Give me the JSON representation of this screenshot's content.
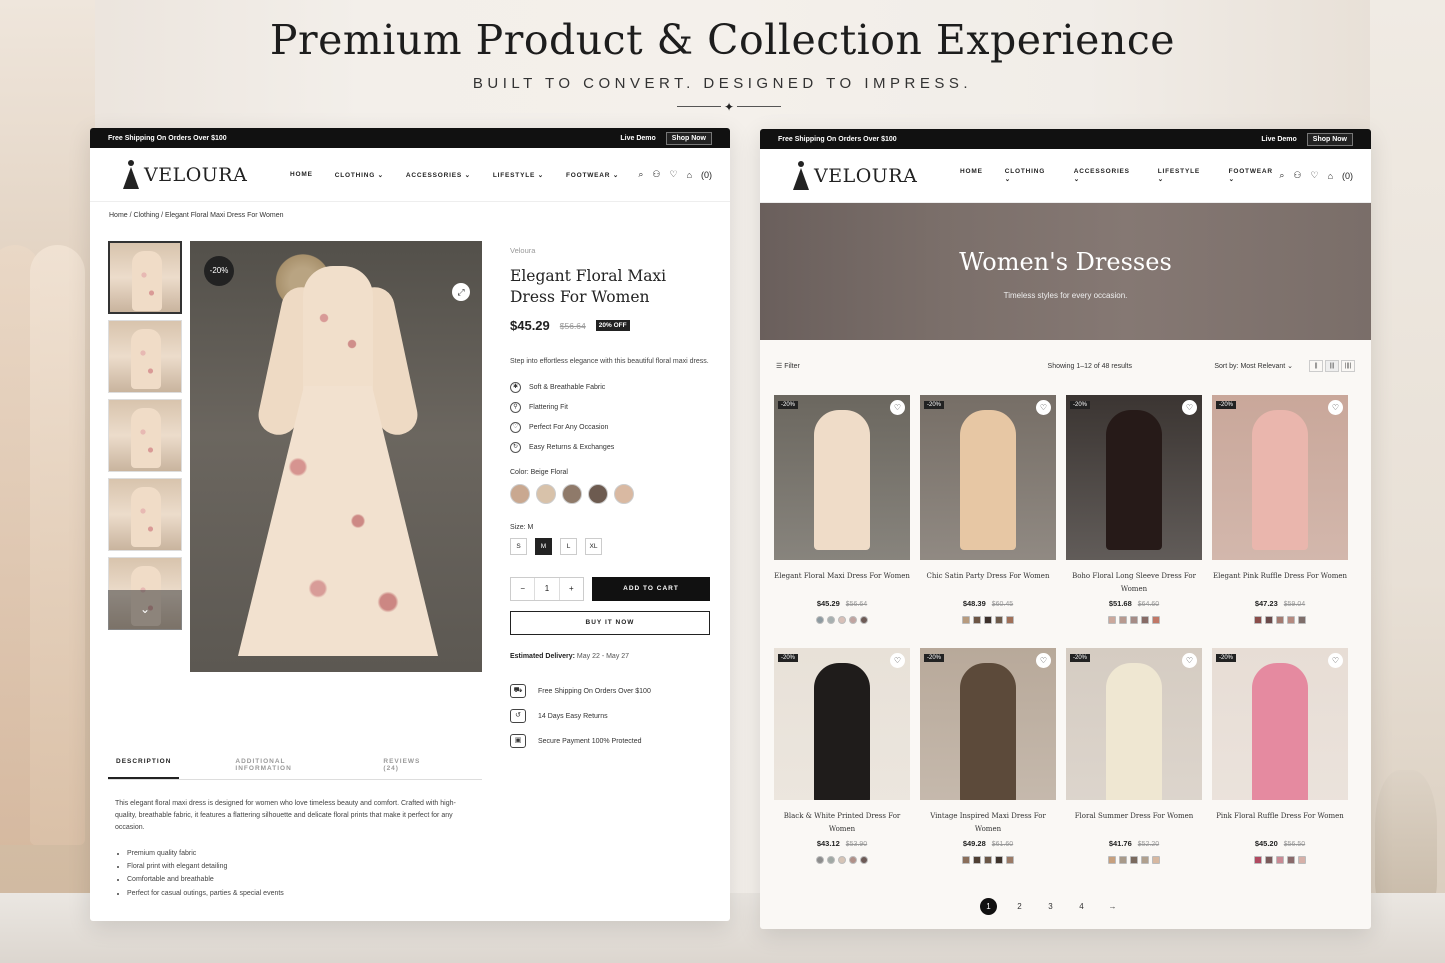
{
  "hero": {
    "title": "Premium Product & Collection Experience",
    "subtitle": "BUILT TO CONVERT. DESIGNED TO IMPRESS.",
    "ornament": "✦"
  },
  "store": {
    "announcement": "Free Shipping On Orders Over $100",
    "live_demo": "Live Demo",
    "shop_now": "Shop Now",
    "logo": "VELOURA",
    "menu": [
      "HOME",
      "CLOTHING ⌄",
      "ACCESSORIES ⌄",
      "LIFESTYLE ⌄",
      "FOOTWEAR ⌄"
    ],
    "cart_count": "(0)",
    "icons": {
      "search": "⌕",
      "user": "⚇",
      "wishlist": "♡",
      "cart": "⌂"
    }
  },
  "product": {
    "breadcrumb": "Home  /  Clothing  /  Elegant Floral Maxi Dress For Women",
    "brand": "Veloura",
    "title": "Elegant Floral Maxi Dress For Women",
    "price": "$45.29",
    "old_price": "$56.64",
    "off": "20% OFF",
    "image_badge": "-20%",
    "short_desc": "Step into effortless elegance with this beautiful floral maxi dress.",
    "features": [
      "Soft & Breathable Fabric",
      "Flattering Fit",
      "Perfect For Any Occasion",
      "Easy Returns & Exchanges"
    ],
    "color_label": "Color: Beige Floral",
    "swatch_colors": [
      "#c9a890",
      "#d8c2aa",
      "#8f7a6a",
      "#6d5b50",
      "#d9b9a2"
    ],
    "size_label": "Size: M",
    "sizes": [
      "S",
      "M",
      "L",
      "XL"
    ],
    "selected_size": "M",
    "qty": "1",
    "minus": "−",
    "plus": "+",
    "add_to_cart": "ADD TO CART",
    "buy_now": "BUY IT NOW",
    "delivery_label": "Estimated Delivery:",
    "delivery": " May 22  -  May 27",
    "services": [
      "Free Shipping On Orders Over $100",
      "14 Days Easy Returns",
      "Secure Payment 100% Protected"
    ],
    "tabs": [
      "DESCRIPTION",
      "ADDITIONAL INFORMATION",
      "REVIEWS (24)"
    ],
    "description": "This elegant floral maxi dress is designed for women who love timeless beauty and comfort. Crafted with high-quality, breathable fabric, it features a flattering silhouette and delicate floral prints that make it perfect for any occasion.",
    "bullets": [
      "Premium quality fabric",
      "Floral print with elegant detailing",
      "Comfortable and breathable",
      "Perfect for casual outings, parties & special events"
    ],
    "thumb_arrow": "⌄",
    "expand": "⤢"
  },
  "collection": {
    "title": "Women's Dresses",
    "subtitle": "Timeless styles for every occasion.",
    "filter": "Filter",
    "showing": "Showing 1–12 of 48 results",
    "sort_label": "Sort by:",
    "sort_value": "Most Relevant  ⌄",
    "products": [
      {
        "name": "Elegant Floral Maxi Dress For Women",
        "price": "$45.29",
        "old": "$56.64",
        "badge": "-20%",
        "bg": "#6b675f",
        "dress": "#efdcc8",
        "swatches": [
          "#8d9aa0",
          "#a7b0b0",
          "#d8c0b8",
          "#c0a4a0",
          "#6d5b56"
        ],
        "sq": false
      },
      {
        "name": "Chic Satin Party Dress For Women",
        "price": "$48.39",
        "old": "$60.45",
        "badge": "-20%",
        "bg": "#766e66",
        "dress": "#e7c7a4",
        "swatches": [
          "#b79b7e",
          "#6c5544",
          "#3c302a",
          "#6d5a4a",
          "#a07058"
        ],
        "sq": true
      },
      {
        "name": "Boho Floral Long Sleeve Dress For Women",
        "price": "$51.68",
        "old": "$64.60",
        "badge": "-20%",
        "bg": "#3b3532",
        "dress": "#261a18",
        "swatches": [
          "#cba89c",
          "#b7998f",
          "#a58c86",
          "#876b66",
          "#c07766"
        ],
        "sq": true
      },
      {
        "name": "Elegant Pink Ruffle Dress For Women",
        "price": "$47.23",
        "old": "$59.04",
        "badge": "-20%",
        "bg": "#c9a79a",
        "dress": "#eab6ad",
        "swatches": [
          "#8a4d4a",
          "#6a4a4a",
          "#a37a70",
          "#b58a80",
          "#7e6e6a"
        ],
        "sq": true
      },
      {
        "name": "Black & White Printed Dress For Women",
        "price": "$43.12",
        "old": "$53.90",
        "badge": "-20%",
        "bg": "#e8e1d8",
        "dress": "#1f1c1b",
        "swatches": [
          "#8c8c8c",
          "#a0a8a4",
          "#d6c4b6",
          "#b09088",
          "#6c5a56"
        ],
        "sq": false
      },
      {
        "name": "Vintage Inspired Maxi Dress For Women",
        "price": "$49.28",
        "old": "$61.60",
        "badge": "-20%",
        "bg": "#b8a99a",
        "dress": "#5c4a3a",
        "swatches": [
          "#8a6e5a",
          "#4e3e32",
          "#6a5646",
          "#3e322a",
          "#9a7a66"
        ],
        "sq": true
      },
      {
        "name": "Floral Summer Dress For Women",
        "price": "$41.76",
        "old": "$52.20",
        "badge": "-20%",
        "bg": "#d5ccc2",
        "dress": "#efe7d2",
        "swatches": [
          "#c7a07e",
          "#a89a8a",
          "#7a6a5e",
          "#b0a08e",
          "#d7b8a0"
        ],
        "sq": true
      },
      {
        "name": "Pink Floral Ruffle Dress For Women",
        "price": "$45.20",
        "old": "$56.50",
        "badge": "-20%",
        "bg": "#e7ddd5",
        "dress": "#e58aa0",
        "swatches": [
          "#b04a60",
          "#7a5a5a",
          "#c98a94",
          "#8a6a6a",
          "#d6b0a8"
        ],
        "sq": true
      }
    ],
    "pages": [
      "1",
      "2",
      "3",
      "4",
      "→"
    ],
    "heart": "♡"
  }
}
